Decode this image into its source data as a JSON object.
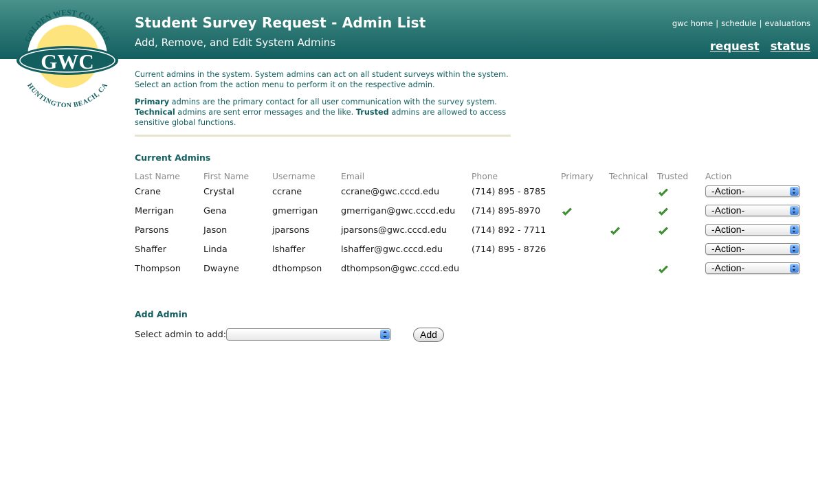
{
  "header": {
    "title": "Student Survey Request - Admin List",
    "subtitle": "Add, Remove, and Edit System Admins",
    "top_links": [
      "gwc home",
      "schedule",
      "evaluations"
    ],
    "main_links": [
      "request",
      "status"
    ]
  },
  "logo": {
    "top_text": "GOLDEN WEST COLLEGE",
    "center_text": "GWC",
    "bottom_text": "HUNTINGTON BEACH, CA"
  },
  "intro": {
    "line1": "Current admins in the system. System admins can act on all student surveys within the system. Select an action from the action menu to perform it on the respective admin.",
    "primary_term": "Primary",
    "primary_desc": " admins are the primary contact for all user communication with the survey system. ",
    "technical_term": "Technical",
    "technical_desc": " admins are sent error messages and the like. ",
    "trusted_term": "Trusted",
    "trusted_desc": " admins are allowed to access sensitive global functions."
  },
  "admins": {
    "title": "Current Admins",
    "columns": [
      "Last Name",
      "First Name",
      "Username",
      "Email",
      "Phone",
      "Primary",
      "Technical",
      "Trusted",
      "Action"
    ],
    "action_default": "-Action-",
    "rows": [
      {
        "last": "Crane",
        "first": "Crystal",
        "username": "ccrane",
        "email": "ccrane@gwc.cccd.edu",
        "phone": "(714) 895 - 8785",
        "primary": false,
        "technical": false,
        "trusted": true
      },
      {
        "last": "Merrigan",
        "first": "Gena",
        "username": "gmerrigan",
        "email": "gmerrigan@gwc.cccd.edu",
        "phone": "(714) 895-8970",
        "primary": true,
        "technical": false,
        "trusted": true
      },
      {
        "last": "Parsons",
        "first": "Jason",
        "username": "jparsons",
        "email": "jparsons@gwc.cccd.edu",
        "phone": "(714) 892 - 7711",
        "primary": false,
        "technical": true,
        "trusted": true
      },
      {
        "last": "Shaffer",
        "first": "Linda",
        "username": "lshaffer",
        "email": "lshaffer@gwc.cccd.edu",
        "phone": "(714) 895 - 8726",
        "primary": false,
        "technical": false,
        "trusted": false
      },
      {
        "last": "Thompson",
        "first": "Dwayne",
        "username": "dthompson",
        "email": "dthompson@gwc.cccd.edu",
        "phone": "",
        "primary": false,
        "technical": false,
        "trusted": true
      }
    ]
  },
  "add_admin": {
    "title": "Add Admin",
    "label": "Select admin to add:",
    "selected": "",
    "button": "Add"
  },
  "colors": {
    "header_top": "#4a918b",
    "header_bottom": "#135f60",
    "accent_text": "#135f60",
    "check_green": "#3e9b2f",
    "logo_sun": "#fde47c"
  }
}
